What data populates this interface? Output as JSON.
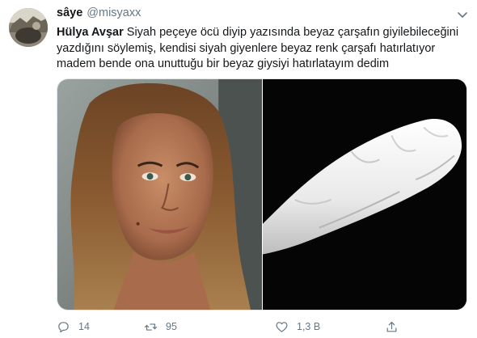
{
  "tweet": {
    "author_name": "sâye",
    "author_handle": "@misyaxx",
    "mention": "Hülya Avşar",
    "text": " Siyah peçeye öcü diyip yazısında beyaz çarşafın giyilebileceğini yazdığını söylemiş, kendisi siyah giyenlere beyaz renk çarşafı hatırlatıyor madem bende ona unuttuğu bir beyaz giysiyi hatırlatayım dedim"
  },
  "media": {
    "left_image": "woman-portrait-photo",
    "right_image": "white-shroud-on-black-photo"
  },
  "actions": {
    "reply_count": "14",
    "retweet_count": "95",
    "like_count": "1,3 B"
  },
  "icons": {
    "reply": "reply-icon",
    "retweet": "retweet-icon",
    "like": "heart-icon",
    "share": "share-icon",
    "caret": "chevron-down-icon"
  },
  "colors": {
    "text": "#14171a",
    "secondary": "#657786",
    "border": "#e1e8ed"
  }
}
